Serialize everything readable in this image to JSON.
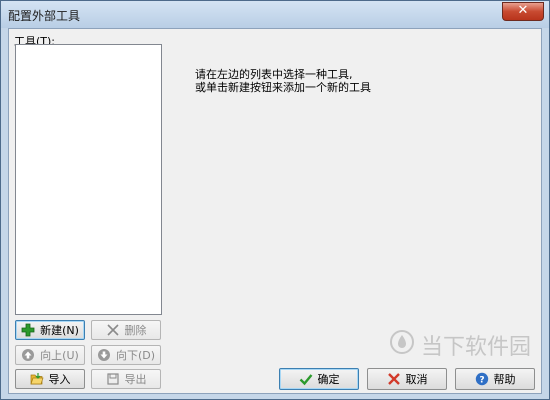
{
  "window": {
    "title": "配置外部工具",
    "close_glyph": "✕"
  },
  "tools": {
    "label": "工具(T):"
  },
  "message": {
    "line1": "请在左边的列表中选择一种工具,",
    "line2": "或单击新建按钮来添加一个新的工具"
  },
  "buttons": {
    "new": "新建(N)",
    "delete": "删除",
    "up": "向上(U)",
    "down": "向下(D)",
    "import": "导入",
    "export": "导出",
    "ok": "确定",
    "cancel": "取消",
    "help": "帮助"
  },
  "watermark": {
    "text": "当下软件园"
  },
  "colors": {
    "accent_green": "#2c9a2c",
    "cancel_red": "#d23a2a",
    "help_blue": "#2f6fc5"
  }
}
